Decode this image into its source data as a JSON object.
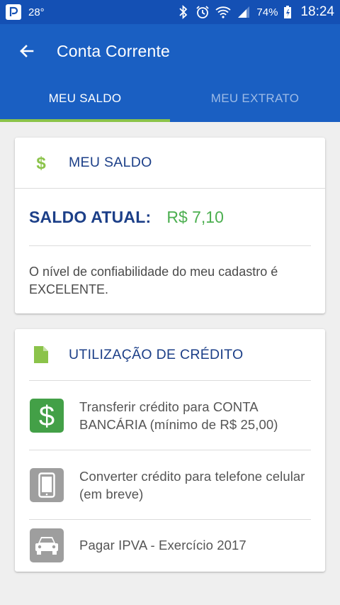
{
  "status_bar": {
    "temperature": "28°",
    "battery": "74%",
    "time": "18:24"
  },
  "app_bar": {
    "title": "Conta Corrente"
  },
  "tabs": [
    {
      "label": "MEU SALDO",
      "active": true
    },
    {
      "label": "MEU EXTRATO",
      "active": false
    }
  ],
  "saldo_card": {
    "header": "MEU SALDO",
    "balance_label": "SALDO ATUAL:",
    "balance_value": "R$ 7,10",
    "trust_message": "O nível de confiabilidade do meu cadastro é EXCELENTE."
  },
  "credit_card": {
    "header": "UTILIZAÇÃO DE CRÉDITO",
    "items": [
      {
        "label": "Transferir crédito para CONTA BANCÁRIA (mínimo de R$ 25,00)",
        "icon": "dollar-icon"
      },
      {
        "label": "Converter crédito para telefone celular (em breve)",
        "icon": "phone-icon"
      },
      {
        "label": "Pagar IPVA - Exercício 2017",
        "icon": "car-icon"
      }
    ]
  },
  "colors": {
    "primary": "#1a5fc2",
    "status_bar": "#1450b4",
    "accent": "#8bc34a",
    "money_green": "#4caf50",
    "heading_blue": "#1c3f88"
  }
}
